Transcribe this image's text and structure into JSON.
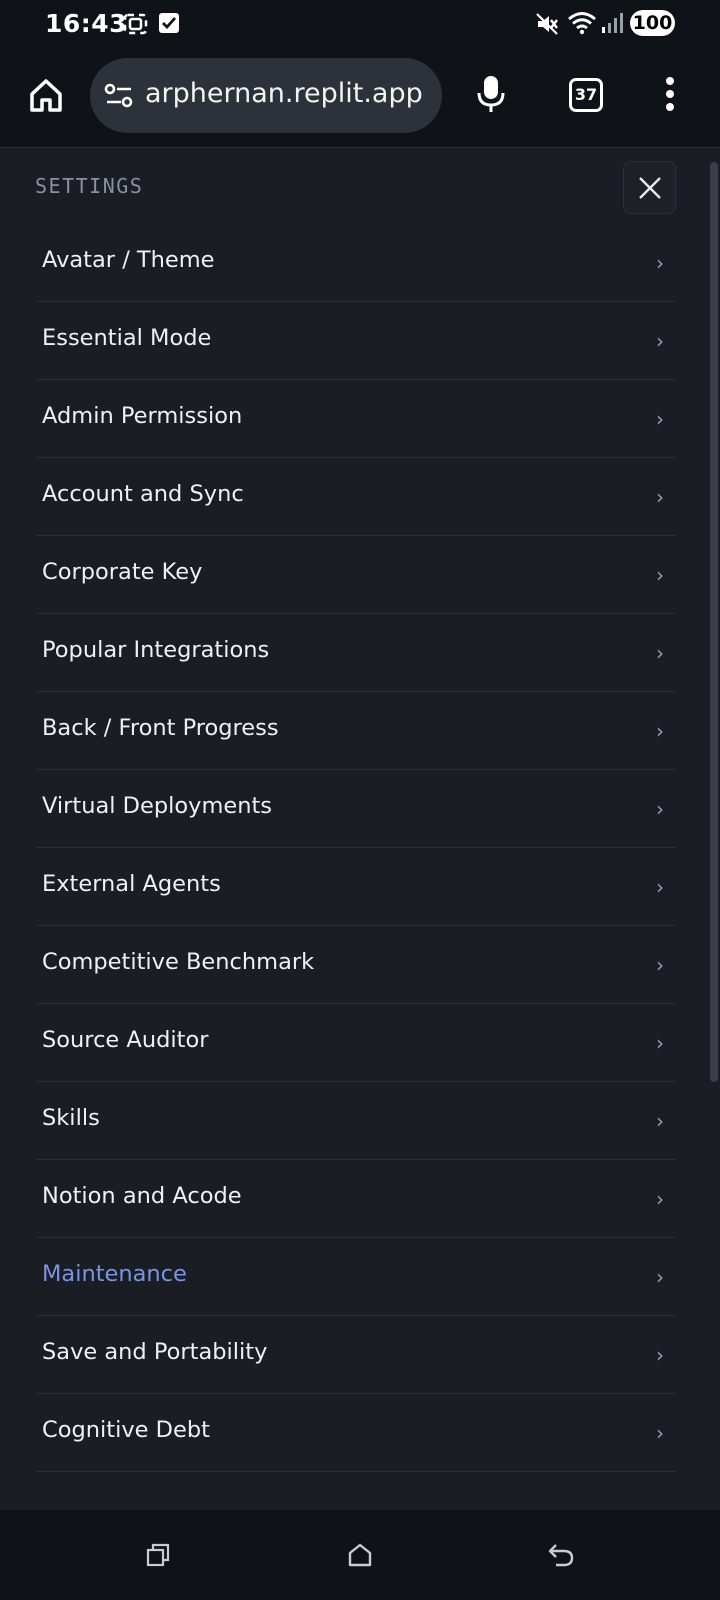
{
  "status_bar": {
    "time": "16:43",
    "battery": "100",
    "icons": [
      "screenshot-icon",
      "notification-check-icon",
      "mute-icon",
      "wifi-icon",
      "signal-icon"
    ]
  },
  "browser": {
    "url": "arphernan.replit.app",
    "tab_count": "37",
    "icons": [
      "home-icon",
      "site-settings-icon",
      "mic-icon",
      "tabs-icon",
      "more-icon"
    ]
  },
  "settings": {
    "title": "SETTINGS",
    "items": [
      {
        "label": "Avatar / Theme"
      },
      {
        "label": "Essential Mode"
      },
      {
        "label": "Admin Permission"
      },
      {
        "label": "Account and Sync"
      },
      {
        "label": "Corporate Key"
      },
      {
        "label": "Popular Integrations"
      },
      {
        "label": "Back / Front Progress"
      },
      {
        "label": "Virtual Deployments"
      },
      {
        "label": "External Agents"
      },
      {
        "label": "Competitive Benchmark"
      },
      {
        "label": "Source Auditor"
      },
      {
        "label": "Skills"
      },
      {
        "label": "Notion and Acode"
      },
      {
        "label": "Maintenance",
        "active": true
      },
      {
        "label": "Save and Portability"
      },
      {
        "label": "Cognitive Debt"
      }
    ],
    "chevron": "›",
    "accent_color": "#7b93e6"
  },
  "navbar": {
    "icons": [
      "recents-icon",
      "home-nav-icon",
      "back-icon"
    ]
  }
}
